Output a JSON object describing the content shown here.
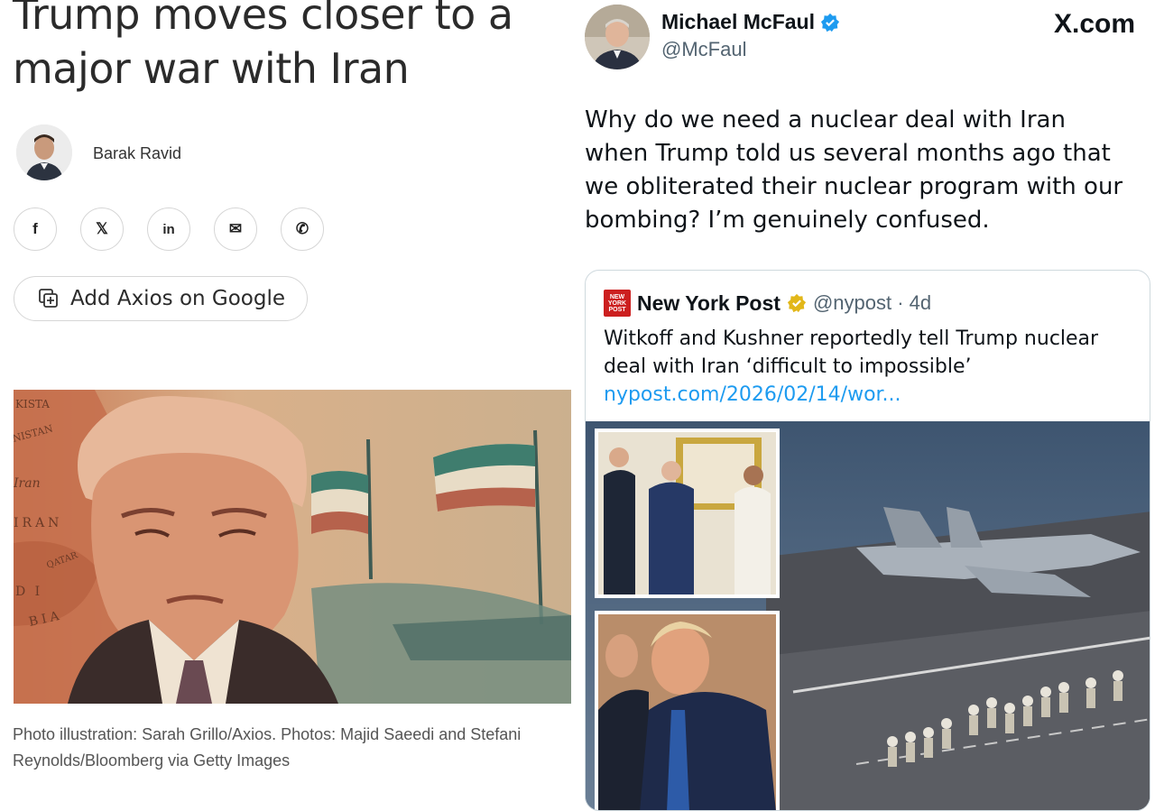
{
  "article": {
    "headline": "Trump moves closer to a major war with Iran",
    "author": "Barak Ravid",
    "share_buttons": [
      {
        "icon": "facebook-icon",
        "glyph": "f"
      },
      {
        "icon": "x-icon",
        "glyph": "𝕏"
      },
      {
        "icon": "linkedin-icon",
        "glyph": "in"
      },
      {
        "icon": "mail-icon",
        "glyph": "✉"
      },
      {
        "icon": "phone-icon",
        "glyph": "✆"
      }
    ],
    "google_button": {
      "icon": "add-source-icon",
      "label": "Add Axios on Google"
    },
    "photo_caption": "Photo illustration: Sarah Grillo/Axios. Photos: Majid Saeedi and Stefani Reynolds/Bloomberg via Getty Images",
    "hero_map_labels": [
      "KISTA",
      "NISTAN",
      "Iran",
      "IRAN",
      "QATAR",
      "D I",
      "BIA"
    ]
  },
  "tweet": {
    "author_name": "Michael McFaul",
    "author_handle": "@McFaul",
    "verified_badge": "verified-badge-icon",
    "site_label": "X.com",
    "text": "Why do we need a nuclear deal with Iran when Trump told us several months ago that we obliterated their nuclear program with our bombing? I’m genuinely confused.",
    "quoted": {
      "logo_text": "NEW YORK POST",
      "name": "New York Post",
      "handle_time": "@nypost · 4d",
      "text": "Witkoff and Kushner reportedly tell Trump nuclear deal with Iran ‘difficult to impossible’ ",
      "link": "nypost.com/2026/02/14/wor..."
    }
  },
  "colors": {
    "link_blue": "#1d9bf0",
    "verified_blue": "#1d9bf0",
    "org_gold": "#e2b719",
    "nypost_red": "#cc1f1f"
  }
}
